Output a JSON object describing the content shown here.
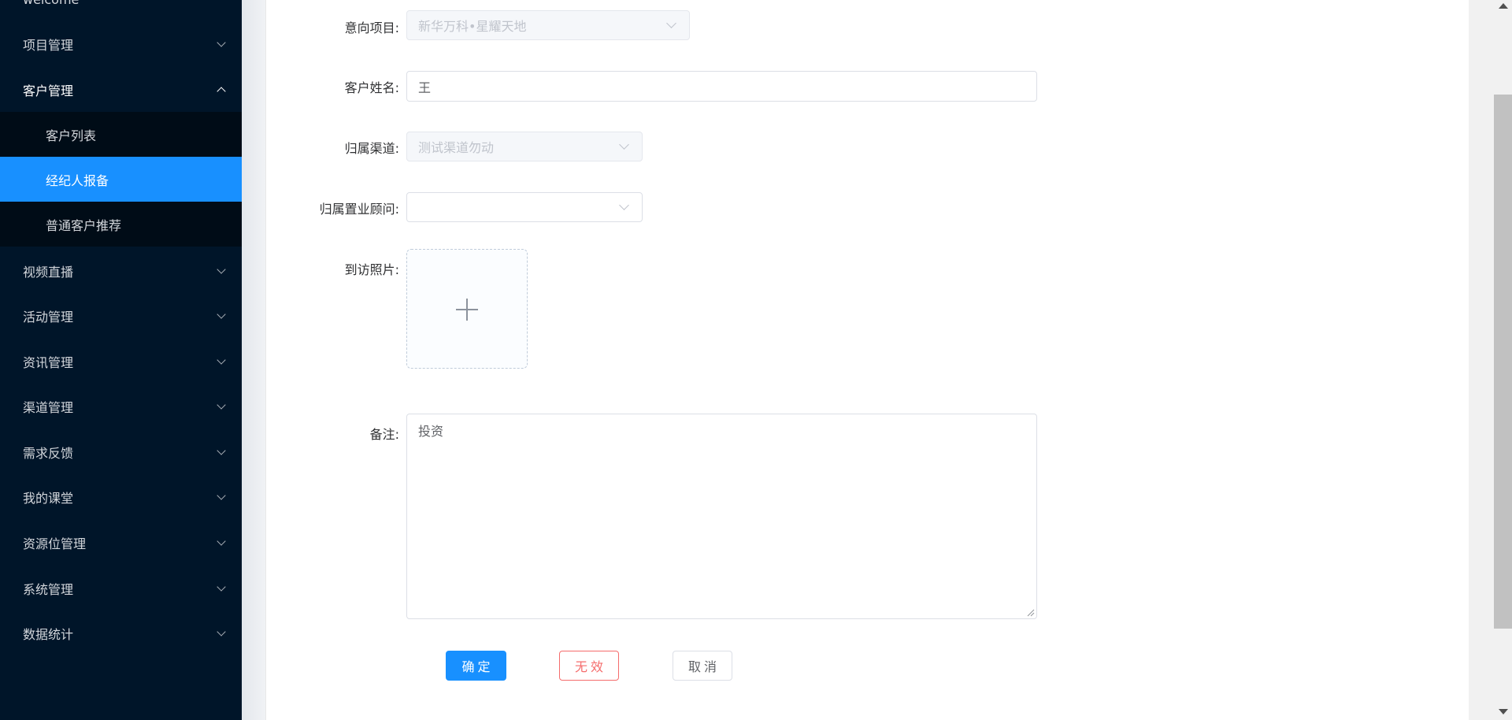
{
  "sidebar": {
    "partial_top_label": "welcome",
    "items": [
      {
        "label": "项目管理"
      },
      {
        "label": "客户管理"
      },
      {
        "label": "视频直播"
      },
      {
        "label": "活动管理"
      },
      {
        "label": "资讯管理"
      },
      {
        "label": "渠道管理"
      },
      {
        "label": "需求反馈"
      },
      {
        "label": "我的课堂"
      },
      {
        "label": "资源位管理"
      },
      {
        "label": "系统管理"
      },
      {
        "label": "数据统计"
      }
    ],
    "submenu": [
      {
        "label": "客户列表"
      },
      {
        "label": "经纪人报备",
        "active": true
      },
      {
        "label": "普通客户推荐"
      }
    ]
  },
  "form": {
    "project": {
      "label": "意向项目:",
      "value": "新华万科•星耀天地"
    },
    "customer_name": {
      "label": "客户姓名:",
      "value": "王"
    },
    "channel": {
      "label": "归属渠道:",
      "value": "测试渠道勿动"
    },
    "consultant": {
      "label": "归属置业顾问:",
      "value": ""
    },
    "visit_photo": {
      "label": "到访照片:"
    },
    "remark": {
      "label": "备注:",
      "value": "投资"
    }
  },
  "buttons": {
    "confirm": "确定",
    "invalid": "无效",
    "cancel": "取消"
  },
  "colors": {
    "sidebar_bg": "#001529",
    "submenu_bg": "#000c17",
    "active": "#1890ff",
    "danger": "#f56c6c"
  }
}
